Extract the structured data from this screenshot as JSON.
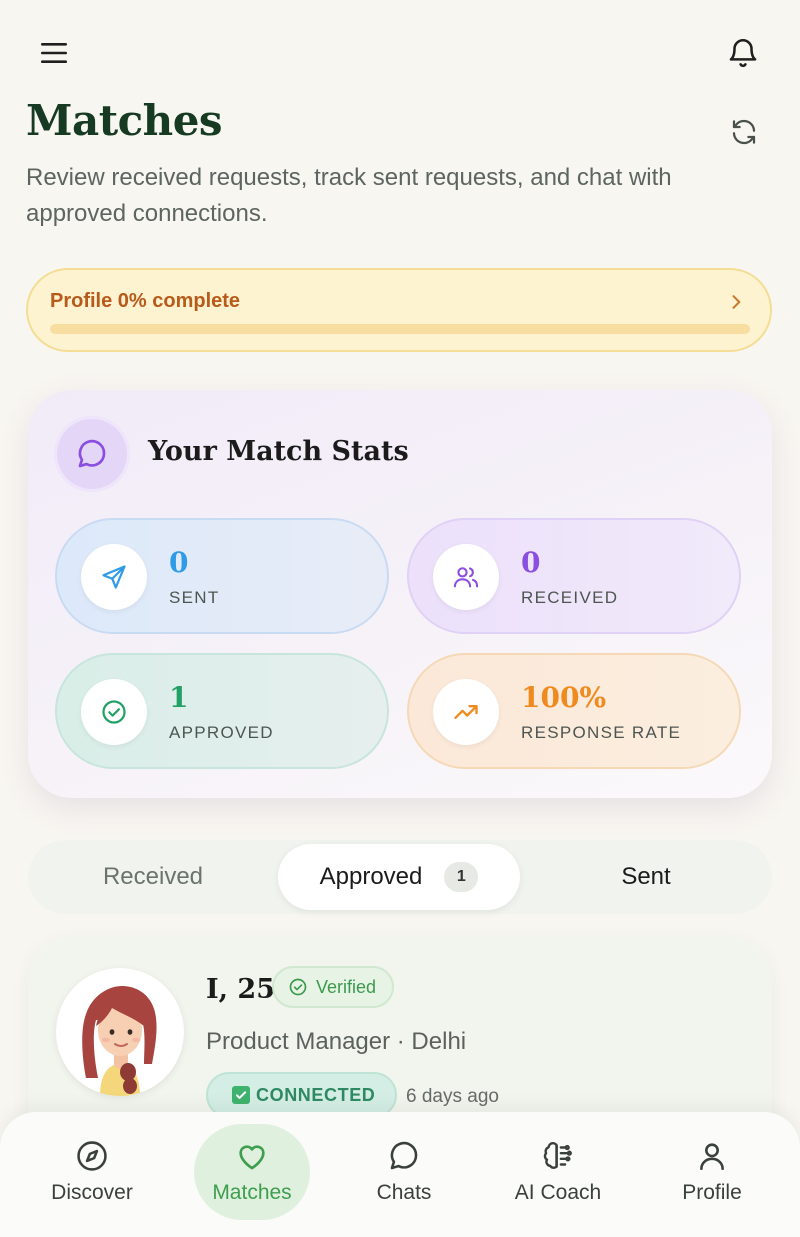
{
  "header": {
    "menu_icon": "hamburger-menu-icon",
    "bell_icon": "bell-icon",
    "title": "Matches",
    "subtitle": "Review received requests, track sent requests, and chat with approved connections.",
    "refresh_icon": "refresh-icon"
  },
  "profile_banner": {
    "text": "Profile 0% complete",
    "progress_percent": 0,
    "colors": {
      "background": "#fdf3d1",
      "text": "#b85a1a"
    }
  },
  "stats": {
    "title": "Your Match Stats",
    "icon": "chat-bubble-icon",
    "tiles": [
      {
        "value": "0",
        "label": "SENT",
        "icon": "send-icon",
        "color": "#2f9be6"
      },
      {
        "value": "0",
        "label": "RECEIVED",
        "icon": "users-icon",
        "color": "#8a4ee0"
      },
      {
        "value": "1",
        "label": "APPROVED",
        "icon": "check-circle-icon",
        "color": "#23a065"
      },
      {
        "value": "100%",
        "label": "RESPONSE RATE",
        "icon": "trending-up-icon",
        "color": "#ef8a1f"
      }
    ]
  },
  "tabs": {
    "received": "Received",
    "approved": "Approved",
    "approved_count": "1",
    "sent": "Sent",
    "active": "Approved"
  },
  "match": {
    "name": "I, 25",
    "verified": "Verified",
    "meta": "Product Manager · Delhi",
    "status": "CONNECTED",
    "time": "6 days ago",
    "avatar_icon": "woman-avatar-icon"
  },
  "bottom_nav": {
    "items": [
      {
        "label": "Discover",
        "icon": "compass-icon"
      },
      {
        "label": "Matches",
        "icon": "heart-icon",
        "active": true
      },
      {
        "label": "Chats",
        "icon": "chat-bubble-icon"
      },
      {
        "label": "AI Coach",
        "icon": "brain-icon"
      },
      {
        "label": "Profile",
        "icon": "user-icon"
      }
    ]
  }
}
